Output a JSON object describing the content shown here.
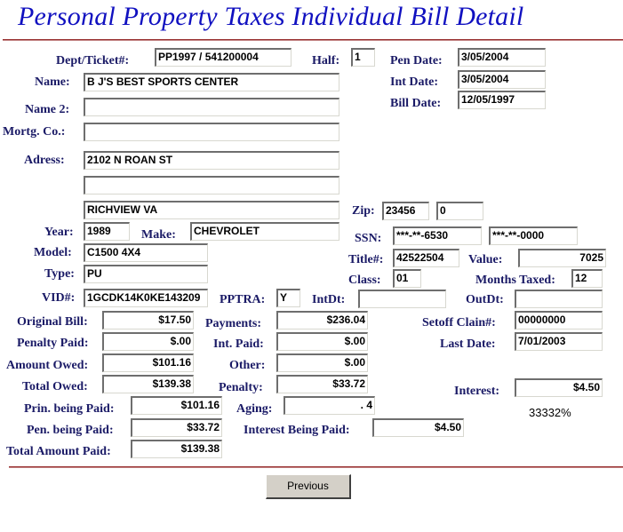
{
  "page": {
    "title": "Personal Property Taxes Individual Bill Detail"
  },
  "fields": {
    "dept_ticket": {
      "label": "Dept/Ticket#:",
      "value": "PP1997 / 541200004"
    },
    "half": {
      "label": "Half:",
      "value": "1"
    },
    "pen_date": {
      "label": "Pen Date:",
      "value": "3/05/2004"
    },
    "int_date": {
      "label": "Int Date:",
      "value": "3/05/2004"
    },
    "bill_date": {
      "label": "Bill Date:",
      "value": "12/05/1997"
    },
    "name": {
      "label": "Name:",
      "value": "B J'S BEST SPORTS CENTER"
    },
    "name2": {
      "label": "Name 2:",
      "value": ""
    },
    "mortg_co": {
      "label": "Mortg. Co.:",
      "value": ""
    },
    "address": {
      "label": "Adress:",
      "line1": "2102 N ROAN ST",
      "line2": "",
      "line3": "RICHVIEW VA"
    },
    "zip": {
      "label": "Zip:",
      "value": "23456",
      "ext": "0"
    },
    "year": {
      "label": "Year:",
      "value": "1989"
    },
    "make": {
      "label": "Make:",
      "value": "CHEVROLET"
    },
    "ssn": {
      "label": "SSN:",
      "value1": "***-**-6530",
      "value2": "***-**-0000"
    },
    "model": {
      "label": "Model:",
      "value": "C1500 4X4"
    },
    "title_no": {
      "label": "Title#:",
      "value": "42522504"
    },
    "value": {
      "label": "Value:",
      "value": "7025"
    },
    "type": {
      "label": "Type:",
      "value": "PU"
    },
    "class": {
      "label": "Class:",
      "value": "01"
    },
    "months_taxed": {
      "label": "Months Taxed:",
      "value": "12"
    },
    "vid": {
      "label": "VID#:",
      "value": "1GCDK14K0KE143209"
    },
    "pptra": {
      "label": "PPTRA:",
      "value": "Y"
    },
    "int_dt": {
      "label": "IntDt:",
      "value": ""
    },
    "out_dt": {
      "label": "OutDt:",
      "value": ""
    },
    "original_bill": {
      "label": "Original Bill:",
      "value": "$17.50"
    },
    "payments": {
      "label": "Payments:",
      "value": "$236.04"
    },
    "setoff_claim": {
      "label": "Setoff Clain#:",
      "value": "00000000"
    },
    "penalty_paid": {
      "label": "Penalty Paid:",
      "value": "$.00"
    },
    "int_paid": {
      "label": "Int. Paid:",
      "value": "$.00"
    },
    "last_date": {
      "label": "Last Date:",
      "value": "7/01/2003"
    },
    "amount_owed": {
      "label": "Amount Owed:",
      "value": "$101.16"
    },
    "other": {
      "label": "Other:",
      "value": "$.00"
    },
    "total_owed": {
      "label": "Total Owed:",
      "value": "$139.38"
    },
    "penalty": {
      "label": "Penalty:",
      "value": "$33.72"
    },
    "interest": {
      "label": "Interest:",
      "value": "$4.50",
      "rate": "33332%"
    },
    "prin_being_paid": {
      "label": "Prin. being Paid:",
      "value": "$101.16"
    },
    "aging": {
      "label": "Aging:",
      "value": ".  4"
    },
    "pen_being_paid": {
      "label": "Pen. being Paid:",
      "value": "$33.72"
    },
    "interest_being_paid": {
      "label": "Interest Being Paid:",
      "value": "$4.50"
    },
    "total_amount_paid": {
      "label": "Total Amount Paid:",
      "value": "$139.38"
    }
  },
  "buttons": {
    "previous": "Previous"
  },
  "colors": {
    "title": "#1010c0",
    "label": "#1a1a66",
    "rule": "#993333",
    "button_face": "#d4d0c8"
  }
}
